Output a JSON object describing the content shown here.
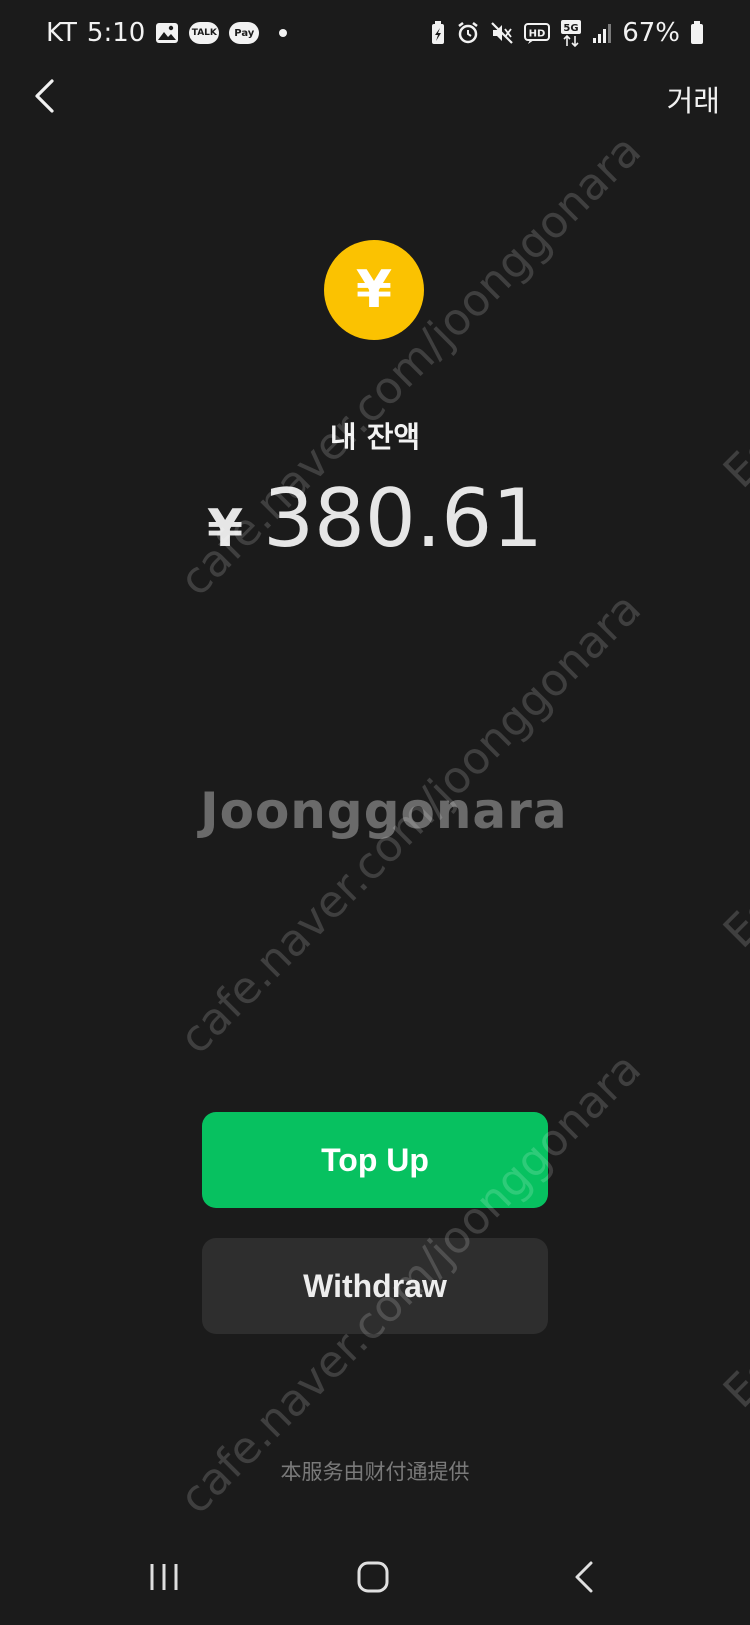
{
  "status_bar": {
    "carrier": "KT",
    "time": "5:10",
    "talk_badge": "TALK",
    "pay_badge": "Pay",
    "network_label": "5G",
    "hd_label": "HD",
    "battery_percent": "67%",
    "icons": [
      "gallery-icon",
      "kakaotalk-icon",
      "kakaopay-icon",
      "notification-dot-icon",
      "battery-saver-icon",
      "alarm-icon",
      "mute-icon",
      "hd-voice-icon",
      "5g-icon",
      "signal-icon",
      "battery-icon"
    ]
  },
  "header": {
    "back_icon": "chevron-left-icon",
    "transactions_label": "거래"
  },
  "wallet": {
    "coin_symbol": "¥",
    "balance_label": "내 잔액",
    "currency_symbol": "¥",
    "amount": "380.61"
  },
  "actions": {
    "top_up_label": "Top Up",
    "withdraw_label": "Withdraw"
  },
  "footer": {
    "provider_text": "本服务由财付通提供"
  },
  "watermark": {
    "brand": "Joonggonara",
    "url": "cafe.naver.com/joonggonara",
    "edge": "Es"
  },
  "colors": {
    "background": "#1b1b1b",
    "coin": "#fbc201",
    "primary_button": "#07c160",
    "secondary_button": "#2e2e2e"
  },
  "android_nav": {
    "icons": [
      "recent-apps-icon",
      "home-icon",
      "back-icon"
    ]
  }
}
